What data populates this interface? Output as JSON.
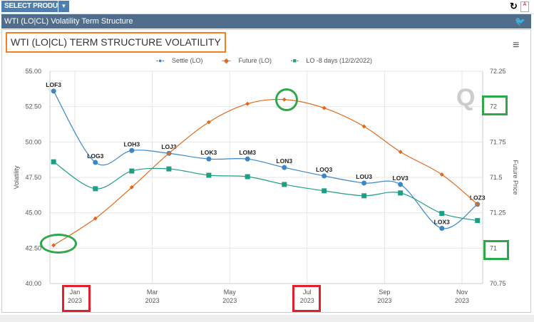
{
  "toolbar": {
    "select_product": "SELECT PRODUCT"
  },
  "header": {
    "title": "WTI (LO|CL) Volatility Term Structure"
  },
  "chart_data": {
    "type": "line",
    "title": "WTI (LO|CL) TERM STRUCTURE VOLATILITY",
    "ylabel": "Volatility",
    "y2label": "Future Price",
    "ylim": [
      40,
      55
    ],
    "y2lim": [
      70.75,
      72.25
    ],
    "yticks": [
      "40.00",
      "42.50",
      "45.00",
      "47.50",
      "50.00",
      "52.50",
      "55.00"
    ],
    "y2ticks": [
      "70.75",
      "71",
      "71.25",
      "71.5",
      "71.75",
      "72",
      "72.25"
    ],
    "xticks": [
      {
        "m": 0,
        "label": "Jan",
        "year": "2023"
      },
      {
        "m": 2,
        "label": "Mar",
        "year": "2023"
      },
      {
        "m": 4,
        "label": "May",
        "year": "2023"
      },
      {
        "m": 6,
        "label": "Jul",
        "year": "2023"
      },
      {
        "m": 8,
        "label": "Sep",
        "year": "2023"
      },
      {
        "m": 10,
        "label": "Nov",
        "year": "2023"
      }
    ],
    "x_months_from_jan2023": [
      -0.55,
      0.53,
      1.47,
      2.43,
      3.46,
      4.46,
      5.41,
      6.44,
      7.47,
      8.41,
      9.48,
      10.4
    ],
    "contracts": [
      "LOF3",
      "LOG3",
      "LOH3",
      "LOJ3",
      "LOK3",
      "LOM3",
      "LON3",
      "LOQ3",
      "LOU3",
      "LOV3",
      "LOX3",
      "LOZ3"
    ],
    "series": [
      {
        "name": "Settle (LO)",
        "color": "#3a87c8",
        "axis": "left",
        "marker": "circle",
        "values": [
          53.6,
          48.56,
          49.4,
          49.2,
          48.8,
          48.8,
          48.2,
          47.6,
          47.1,
          47.0,
          43.9,
          45.6
        ]
      },
      {
        "name": "Future (LO)",
        "color": "#e06a1a",
        "axis": "right",
        "marker": "diamond",
        "values": [
          71.02,
          71.21,
          71.43,
          71.67,
          71.89,
          72.02,
          72.05,
          71.99,
          71.86,
          71.68,
          71.52,
          71.31
        ]
      },
      {
        "name": "LO -8 days (12/2/2022)",
        "color": "#1f9e86",
        "axis": "left",
        "marker": "square",
        "values": [
          48.6,
          46.7,
          47.95,
          48.1,
          47.65,
          47.55,
          47.0,
          46.55,
          46.2,
          46.4,
          44.95,
          44.45
        ]
      }
    ],
    "legend": "top-center",
    "grid": true
  }
}
